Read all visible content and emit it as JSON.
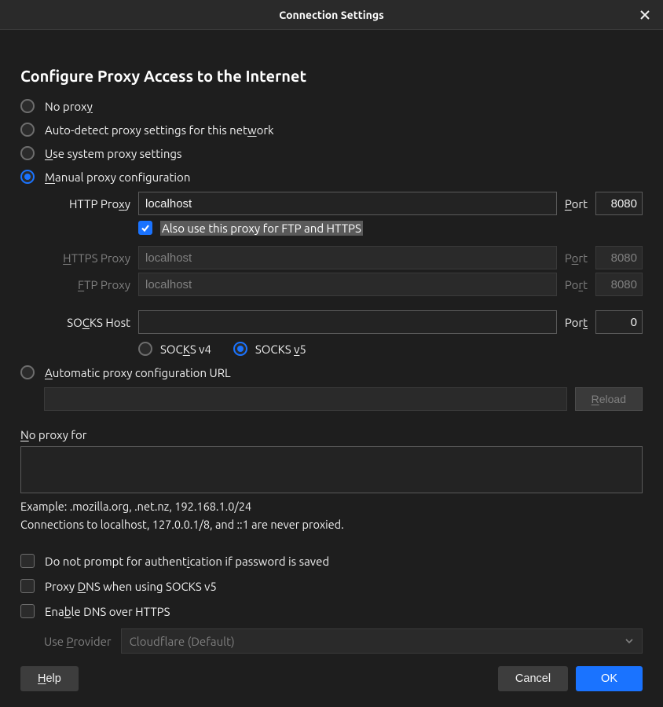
{
  "titlebar": {
    "title": "Connection Settings"
  },
  "section_title": "Configure Proxy Access to the Internet",
  "proxy_modes": {
    "no_proxy": {
      "pre": "No prox",
      "u": "y",
      "post": ""
    },
    "auto_detect": {
      "pre": "Auto-detect proxy settings for this net",
      "u": "w",
      "post": "ork"
    },
    "system": {
      "pre": "",
      "u": "U",
      "post": "se system proxy settings"
    },
    "manual": {
      "pre": "",
      "u": "M",
      "post": "anual proxy configuration"
    },
    "auto_url": {
      "pre": "",
      "u": "A",
      "post": "utomatic proxy configuration URL"
    }
  },
  "http": {
    "label": {
      "pre": "HTTP Pro",
      "u": "x",
      "post": "y"
    },
    "value": "localhost",
    "port_label": {
      "pre": "",
      "u": "P",
      "post": "ort"
    },
    "port": "8080"
  },
  "share_proxy": {
    "pre": "Also use this proxy for FTP and HTTPS"
  },
  "https": {
    "label": {
      "pre": "",
      "u": "H",
      "post": "TTPS Proxy"
    },
    "value": "localhost",
    "port_label": {
      "pre": "P",
      "u": "o",
      "post": "rt"
    },
    "port": "8080"
  },
  "ftp": {
    "label": {
      "pre": "",
      "u": "F",
      "post": "TP Proxy"
    },
    "value": "localhost",
    "port_label": {
      "pre": "Po",
      "u": "r",
      "post": "t"
    },
    "port": "8080"
  },
  "socks": {
    "label": {
      "pre": "SO",
      "u": "C",
      "post": "KS Host"
    },
    "value": "",
    "port_label": {
      "pre": "Por",
      "u": "t",
      "post": ""
    },
    "port": "0",
    "v4": {
      "pre": "SOC",
      "u": "K",
      "post": "S v4"
    },
    "v5": {
      "pre": "SOCKS ",
      "u": "v",
      "post": "5"
    }
  },
  "reload_label": "Reload",
  "reload_u": "R",
  "no_proxy_for": {
    "pre": "",
    "u": "N",
    "post": "o proxy for"
  },
  "no_proxy_value": "",
  "hint1": "Example: .mozilla.org, .net.nz, 192.168.1.0/24",
  "hint2": "Connections to localhost, 127.0.0.1/8, and ::1 are never proxied.",
  "opts": {
    "no_prompt": {
      "pre": "Do not prompt for authent",
      "u": "i",
      "post": "cation if password is saved"
    },
    "proxy_dns": {
      "pre": "Proxy ",
      "u": "D",
      "post": "NS when using SOCKS v5"
    },
    "doh": {
      "pre": "Ena",
      "u": "b",
      "post": "le DNS over HTTPS"
    }
  },
  "provider": {
    "label": {
      "pre": "Use ",
      "u": "P",
      "post": "rovider"
    },
    "value": "Cloudflare (Default)"
  },
  "footer": {
    "help": {
      "u": "H",
      "post": "elp"
    },
    "cancel": "Cancel",
    "ok": "OK"
  }
}
